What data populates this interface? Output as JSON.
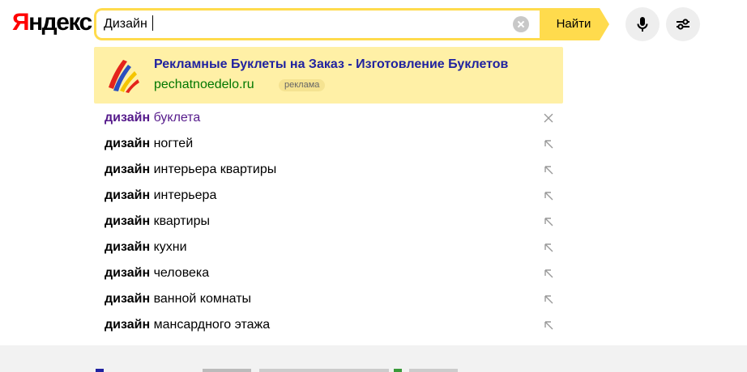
{
  "logo": {
    "first": "Я",
    "rest": "ндекс"
  },
  "search": {
    "query": "Дизайн ",
    "button_label": "Найти"
  },
  "ad": {
    "title": "Рекламные Буклеты на Заказ - Изготовление Буклетов",
    "url": "pechatnoedelo.ru",
    "badge": "реклама"
  },
  "suggestions": [
    {
      "bold": "дизайн",
      "rest": " буклета",
      "visited": true,
      "action": "remove"
    },
    {
      "bold": "дизайн",
      "rest": " ногтей",
      "visited": false,
      "action": "insert"
    },
    {
      "bold": "дизайн",
      "rest": " интерьера квартиры",
      "visited": false,
      "action": "insert"
    },
    {
      "bold": "дизайн",
      "rest": " интерьера",
      "visited": false,
      "action": "insert"
    },
    {
      "bold": "дизайн",
      "rest": " квартиры",
      "visited": false,
      "action": "insert"
    },
    {
      "bold": "дизайн",
      "rest": " кухни",
      "visited": false,
      "action": "insert"
    },
    {
      "bold": "дизайн",
      "rest": " человека",
      "visited": false,
      "action": "insert"
    },
    {
      "bold": "дизайн",
      "rest": " ванной комнаты",
      "visited": false,
      "action": "insert"
    },
    {
      "bold": "дизайн",
      "rest": " мансардного этажа",
      "visited": false,
      "action": "insert"
    }
  ],
  "icons": {
    "mic": "microphone-icon",
    "settings": "sliders-icon",
    "remove": "close-icon",
    "insert": "arrow-up-left-icon"
  },
  "colors": {
    "accent_yellow": "#ffdb4d",
    "ad_background": "#fff0a6",
    "ad_title": "#2022a0",
    "ad_url": "#007700",
    "visited_link": "#551a8b",
    "logo_red": "#ff0000"
  }
}
